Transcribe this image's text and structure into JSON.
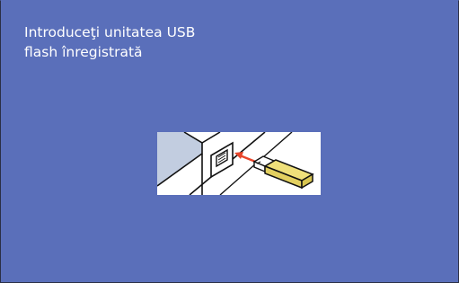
{
  "message": {
    "line1": "Introduceţi unitatea USB",
    "line2": "flash înregistrată"
  },
  "illustration": {
    "icon": "usb-insert-illustration",
    "background": "#5a6fba",
    "arrow_color": "#e8452a",
    "usb_color": "#efe07a"
  }
}
